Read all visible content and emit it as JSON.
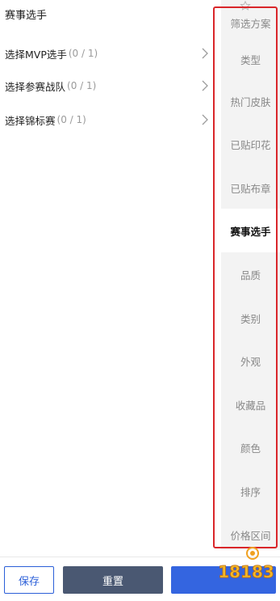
{
  "page_title": "赛事选手",
  "options": [
    {
      "label": "选择MVP选手",
      "count": "(0 / 1)"
    },
    {
      "label": "选择参赛战队",
      "count": "(0 / 1)"
    },
    {
      "label": "选择锦标赛",
      "count": "(0 / 1)"
    }
  ],
  "sidebar": {
    "items": [
      {
        "label": "筛选方案"
      },
      {
        "label": "类型"
      },
      {
        "label": "热门皮肤"
      },
      {
        "label": "已贴印花"
      },
      {
        "label": "已贴布章"
      },
      {
        "label": "赛事选手"
      },
      {
        "label": "品质"
      },
      {
        "label": "类别"
      },
      {
        "label": "外观"
      },
      {
        "label": "收藏品"
      },
      {
        "label": "颜色"
      },
      {
        "label": "排序"
      },
      {
        "label": "价格区间"
      }
    ],
    "active": "赛事选手"
  },
  "bottom_bar": {
    "save_label": "保存",
    "reset_label": "重置",
    "confirm_label": ""
  },
  "watermark": {
    "text": "18183"
  },
  "colors": {
    "accent": "#3465e0",
    "reset_button": "#4a5872",
    "highlight_border": "#d9262a",
    "sidebar_bg": "#f3f3f3"
  },
  "icons": {
    "option_chevron": "chevron-right-icon",
    "top_icon": "star-outline-icon"
  }
}
